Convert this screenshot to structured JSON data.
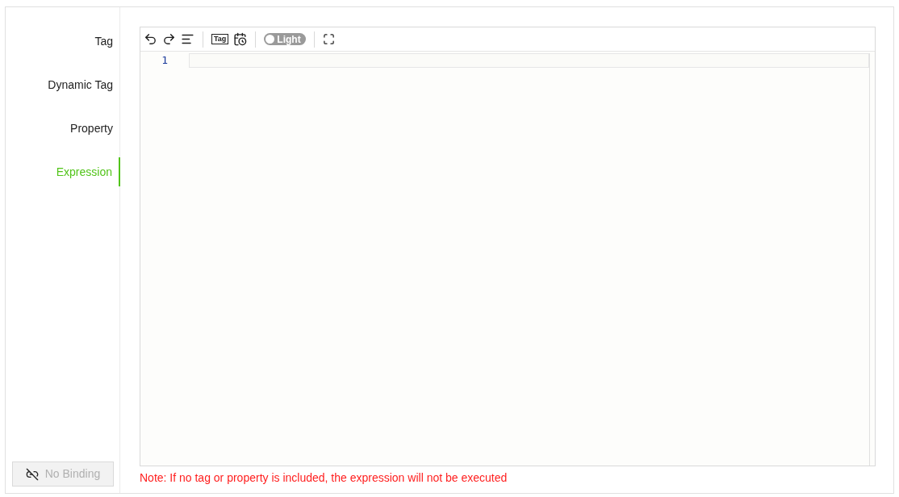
{
  "sidebar": {
    "items": [
      {
        "label": "Tag",
        "selected": false
      },
      {
        "label": "Dynamic Tag",
        "selected": false
      },
      {
        "label": "Property",
        "selected": false
      },
      {
        "label": "Expression",
        "selected": true
      }
    ],
    "binding_button": {
      "label": "No Binding",
      "disabled": true
    }
  },
  "toolbar": {
    "tag_icon_text": "Tag",
    "theme_toggle": {
      "label": "Light",
      "on": false
    }
  },
  "editor": {
    "line_numbers": [
      "1"
    ]
  },
  "note": "Note: If no tag or property is included, the expression will not be executed"
}
